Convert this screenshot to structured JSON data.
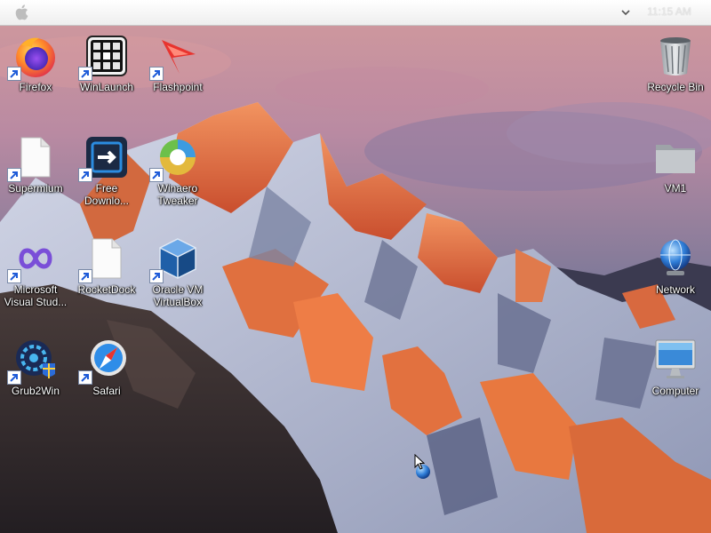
{
  "menubar": {
    "clock": "11:15 AM",
    "apple_icon": "apple-logo-icon",
    "chevron_icon": "chevron-down-icon"
  },
  "desktop": {
    "icons": [
      {
        "id": "firefox",
        "label": "Firefox",
        "icon": "firefox-icon",
        "shortcut": true
      },
      {
        "id": "winlaunch",
        "label": "WinLaunch",
        "icon": "winlaunch-icon",
        "shortcut": true
      },
      {
        "id": "flashpoint",
        "label": "Flashpoint",
        "icon": "flashpoint-icon",
        "shortcut": true
      },
      {
        "id": "recycle-bin",
        "label": "Recycle Bin",
        "icon": "recycle-bin-icon",
        "shortcut": false
      },
      {
        "id": "supermium",
        "label": "Supermium",
        "icon": "file-icon",
        "shortcut": true
      },
      {
        "id": "free-download",
        "label": "Free Downlo...",
        "icon": "free-download-manager-icon",
        "shortcut": true
      },
      {
        "id": "winaero",
        "label": "Winaero Tweaker",
        "icon": "winaero-tweaker-icon",
        "shortcut": true
      },
      {
        "id": "vm1",
        "label": "VM1",
        "icon": "folder-icon",
        "shortcut": false
      },
      {
        "id": "visual-studio",
        "label": "Microsoft Visual Stud...",
        "icon": "visual-studio-icon",
        "shortcut": true
      },
      {
        "id": "rocketdock",
        "label": "RocketDock",
        "icon": "file-icon",
        "shortcut": true
      },
      {
        "id": "virtualbox",
        "label": "Oracle VM VirtualBox",
        "icon": "virtualbox-icon",
        "shortcut": true
      },
      {
        "id": "network",
        "label": "Network",
        "icon": "network-globe-icon",
        "shortcut": false
      },
      {
        "id": "grub2win",
        "label": "Grub2Win",
        "icon": "grub2win-icon",
        "shortcut": true
      },
      {
        "id": "safari",
        "label": "Safari",
        "icon": "safari-compass-icon",
        "shortcut": true
      },
      {
        "id": "computer",
        "label": "Computer",
        "icon": "computer-monitor-icon",
        "shortcut": false
      }
    ]
  },
  "colors": {
    "sky_top": "#c98f9f",
    "sky_bottom": "#6b6f93",
    "mountain_glow": "#e8734a",
    "snow": "#c9cfe0",
    "rock_dark": "#2e2a2e"
  }
}
